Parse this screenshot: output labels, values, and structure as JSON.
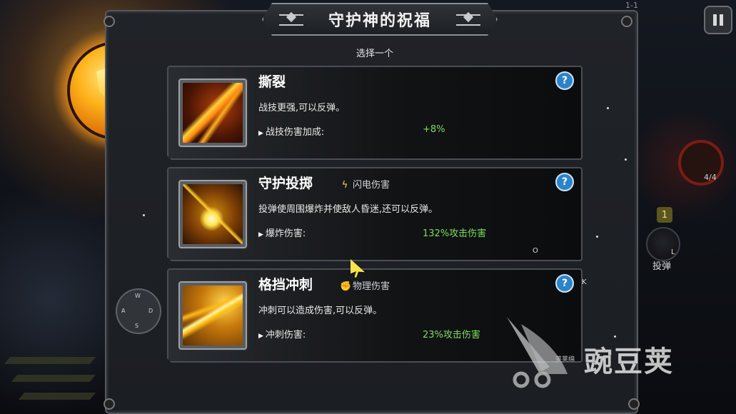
{
  "title": "守护神的祝福",
  "subtitle": "选择一个",
  "level": "1-1",
  "cards": [
    {
      "name": "撕裂",
      "tag_icon": "",
      "tag": "",
      "description": "战技更强,可以反弹。",
      "stat_label": "战技伤害加成:",
      "stat_value": "+8%",
      "help": "?"
    },
    {
      "name": "守护投掷",
      "tag_icon": "lightning-icon",
      "tag": "闪电伤害",
      "description": "投弹使周围爆炸并使敌人昏迷,还可以反弹。",
      "stat_label": "爆炸伤害:",
      "stat_value": "132%攻击伤害",
      "help": "?"
    },
    {
      "name": "格挡冲刺",
      "tag_icon": "fist-icon",
      "tag": "物理伤害",
      "description": "冲刺可以造成伤害,可以反弹。",
      "stat_label": "冲刺伤害:",
      "stat_value": "23%攻击伤害",
      "help": "?"
    }
  ],
  "hud": {
    "ring_counter": "4/4",
    "bomb_count": "1",
    "bomb_key": "L",
    "bomb_label": "投弹",
    "dash_key": "K",
    "throw_key": "O",
    "wasd": {
      "up": "W",
      "left": "A",
      "right": "D",
      "down": "S"
    }
  },
  "watermark": {
    "text": "豌豆荚",
    "small": "荚荚绵"
  },
  "colors": {
    "stat_green": "#7ddf5c",
    "help_blue": "#2b83c9",
    "shield_gold": "#ffb21a"
  }
}
